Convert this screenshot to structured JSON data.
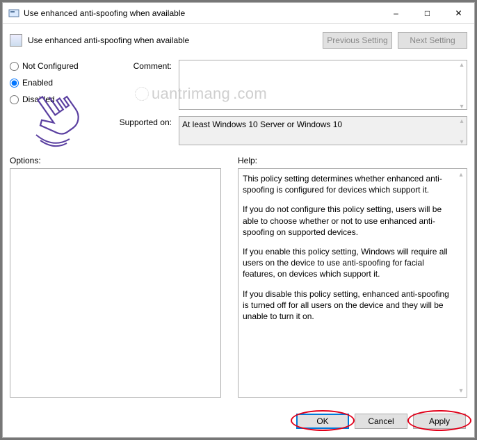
{
  "window": {
    "title": "Use enhanced anti-spoofing when available"
  },
  "header": {
    "title": "Use enhanced anti-spoofing when available",
    "prev": "Previous Setting",
    "next": "Next Setting"
  },
  "radios": {
    "not_configured": "Not Configured",
    "enabled": "Enabled",
    "disabled": "Disabled",
    "selected": "enabled"
  },
  "labels": {
    "comment": "Comment:",
    "supported_on": "Supported on:",
    "options": "Options:",
    "help": "Help:"
  },
  "fields": {
    "comment": "",
    "supported_on": "At least Windows 10 Server or Windows 10"
  },
  "panes": {
    "options": "",
    "help_p1": "This policy setting determines whether enhanced anti-spoofing is configured for devices which support it.",
    "help_p2": "If you do not configure this policy setting, users will be able to choose whether or not to use enhanced anti-spoofing on supported devices.",
    "help_p3": "If you enable this policy setting, Windows will require all users on the device to use anti-spoofing for facial features, on devices which support it.",
    "help_p4": "If you disable this policy setting, enhanced anti-spoofing is turned off for all users on the device and they will be unable to turn it on."
  },
  "buttons": {
    "ok": "OK",
    "cancel": "Cancel",
    "apply": "Apply"
  },
  "watermark": "uantrimang"
}
